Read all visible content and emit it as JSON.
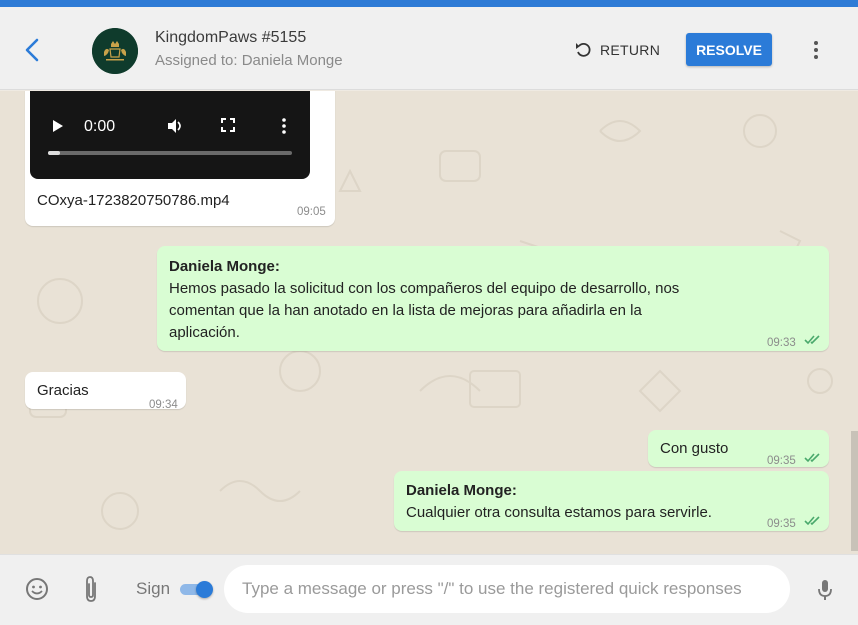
{
  "header": {
    "title": "KingdomPaws #5155",
    "subtitle": "Assigned to: Daniela Monge",
    "return_label": "RETURN",
    "resolve_label": "RESOLVE"
  },
  "messages": [
    {
      "type": "video",
      "direction": "in",
      "video_time": "0:00",
      "filename": "COxya-1723820750786.mp4",
      "time": "09:05"
    },
    {
      "type": "text",
      "direction": "out",
      "sender": "Daniela Monge:",
      "lines": [
        "Hemos pasado la solicitud con los compañeros del equipo de desarrollo, nos",
        "comentan que la han anotado en la lista de mejoras para añadirla en la",
        "aplicación."
      ],
      "time": "09:33",
      "status": "read"
    },
    {
      "type": "text",
      "direction": "in",
      "text": "Gracias",
      "time": "09:34"
    },
    {
      "type": "text",
      "direction": "out",
      "text": "Con gusto",
      "time": "09:35",
      "status": "read"
    },
    {
      "type": "text",
      "direction": "out",
      "sender": "Daniela Monge:",
      "text": "Cualquier otra consulta estamos para servirle.",
      "time": "09:35",
      "status": "read"
    }
  ],
  "composer": {
    "sign_label": "Sign",
    "sign_enabled": true,
    "placeholder": "Type a message or press \"/\" to use the registered quick responses"
  },
  "colors": {
    "accent": "#2b7bd8",
    "outgoing_bubble": "#d9fdd3",
    "incoming_bubble": "#ffffff",
    "read_ticks": "#53bdeb"
  },
  "icons": [
    "back-arrow-icon",
    "avatar-logo",
    "return-icon",
    "more-vert-icon",
    "play-icon",
    "volume-icon",
    "fullscreen-icon",
    "video-more-icon",
    "double-check-icon",
    "emoji-icon",
    "attach-icon",
    "mic-icon"
  ]
}
